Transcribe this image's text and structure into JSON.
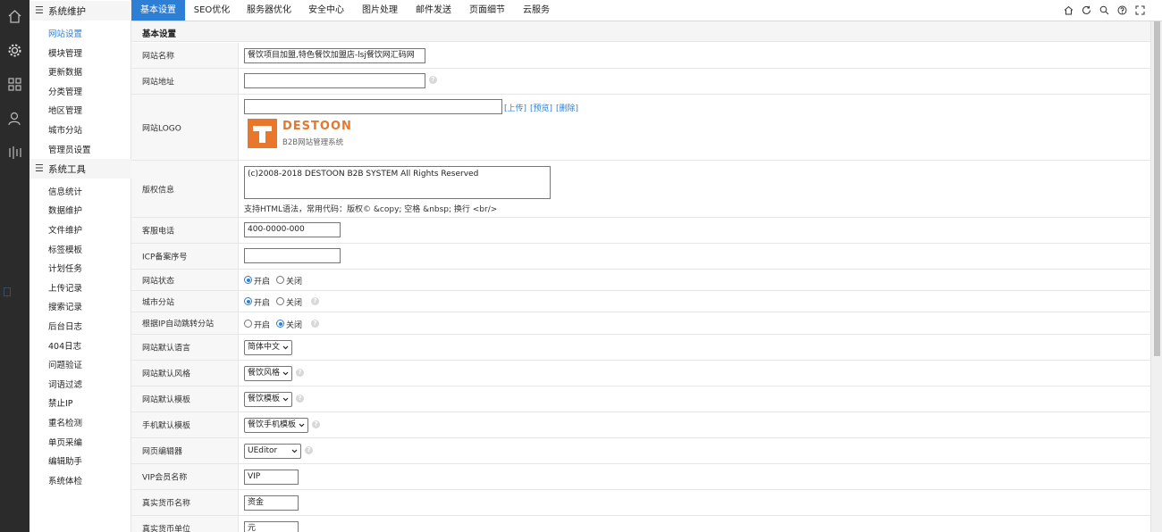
{
  "rail": {
    "icons": [
      "home-icon",
      "gear-icon",
      "grid-icon",
      "user-icon",
      "bars-icon"
    ]
  },
  "sidebar": {
    "group1": {
      "label": "系统维护",
      "items": [
        "网站设置",
        "模块管理",
        "更新数据",
        "分类管理",
        "地区管理",
        "城市分站",
        "管理员设置"
      ]
    },
    "group2": {
      "label": "系统工具",
      "items": [
        "信息统计",
        "数据维护",
        "文件维护",
        "标签模板",
        "计划任务",
        "上传记录",
        "搜索记录",
        "后台日志",
        "404日志",
        "问题验证",
        "词语过滤",
        "禁止IP",
        "重名检测",
        "单页采编",
        "编辑助手",
        "系统体检"
      ]
    }
  },
  "tabs": [
    "基本设置",
    "SEO优化",
    "服务器优化",
    "安全中心",
    "图片处理",
    "邮件发送",
    "页面细节",
    "云服务"
  ],
  "toolbar_icons": [
    "home-icon",
    "refresh-icon",
    "search-icon",
    "help-icon",
    "fullscreen-icon"
  ],
  "section_title": "基本设置",
  "form": {
    "site_name": {
      "label": "网站名称",
      "value": "餐饮项目加盟,特色餐饮加盟店-lsj餐饮网汇码网"
    },
    "site_url": {
      "label": "网站地址",
      "value": ""
    },
    "site_logo": {
      "label": "网站LOGO",
      "value": "",
      "upload": "[上传]",
      "preview": "[预览]",
      "delete": "[删除]"
    },
    "logo_image": {
      "brand": "DESTOON",
      "tagline": "B2B网站管理系统"
    },
    "copyright": {
      "label": "版权信息",
      "value": "(c)2008-2018 DESTOON B2B SYSTEM All Rights Reserved",
      "hint": "支持HTML语法，常用代码：版权© &copy; 空格 &nbsp; 换行 <br/>"
    },
    "service_phone": {
      "label": "客服电话",
      "value": "400-0000-000"
    },
    "icp": {
      "label": "ICP备案序号",
      "value": ""
    },
    "site_status": {
      "label": "网站状态",
      "on": "开启",
      "off": "关闭",
      "selected": "on"
    },
    "city_branch": {
      "label": "城市分站",
      "on": "开启",
      "off": "关闭",
      "selected": "on"
    },
    "ip_redirect": {
      "label": "根据IP自动跳转分站",
      "on": "开启",
      "off": "关闭",
      "selected": "off"
    },
    "language": {
      "label": "网站默认语言",
      "value": "简体中文"
    },
    "style": {
      "label": "网站默认风格",
      "value": "餐饮风格"
    },
    "template": {
      "label": "网站默认模板",
      "value": "餐饮模板"
    },
    "mobile_template": {
      "label": "手机默认模板",
      "value": "餐饮手机模板"
    },
    "editor": {
      "label": "网页编辑器",
      "value": "UEditor"
    },
    "vip_name": {
      "label": "VIP会员名称",
      "value": "VIP"
    },
    "currency_name": {
      "label": "真实货币名称",
      "value": "资金"
    },
    "currency_unit": {
      "label": "真实货币单位",
      "value": "元"
    }
  },
  "colors": {
    "accent": "#2d7fd6",
    "rail_bg": "#2b2b2b",
    "label_bg": "#f7f7f7"
  }
}
